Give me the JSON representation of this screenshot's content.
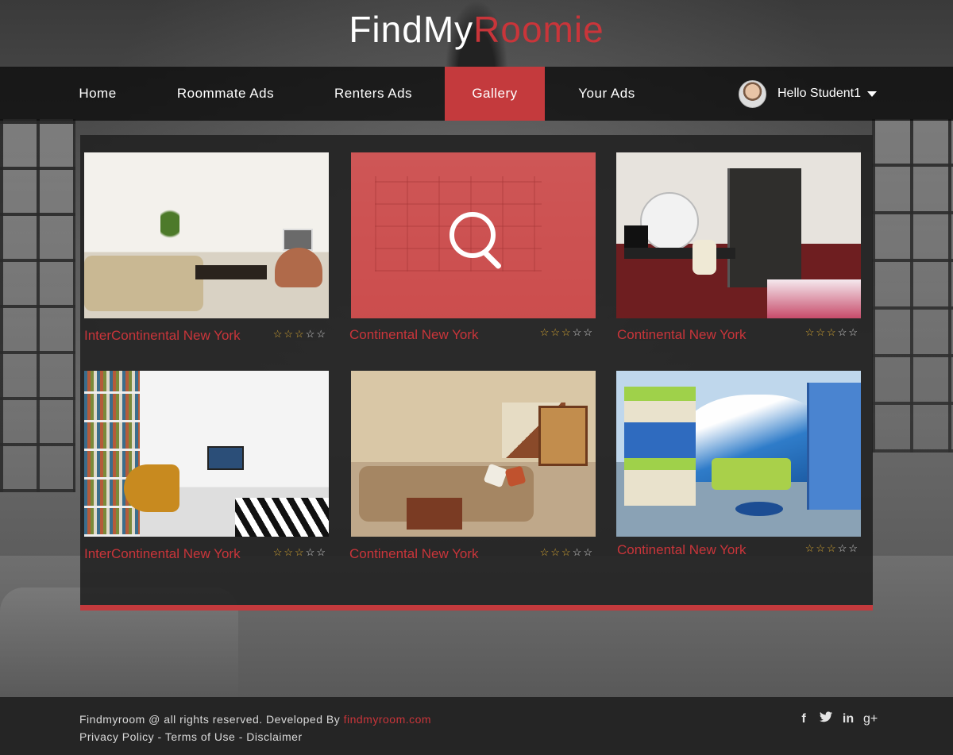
{
  "logo": {
    "part1": "FindMy",
    "part2": "Roomie"
  },
  "nav": {
    "items": [
      {
        "label": "Home"
      },
      {
        "label": "Roommate Ads"
      },
      {
        "label": "Renters Ads"
      },
      {
        "label": "Gallery",
        "active": true
      },
      {
        "label": "Your Ads"
      }
    ],
    "user_greeting": "Hello Student1"
  },
  "gallery": [
    {
      "title": "InterContinental New York",
      "rating": 3,
      "max_rating": 5
    },
    {
      "title": "Continental New York",
      "rating": 3,
      "max_rating": 5,
      "hover": true
    },
    {
      "title": "Continental New York",
      "rating": 3,
      "max_rating": 5
    },
    {
      "title": "InterContinental New York",
      "rating": 3,
      "max_rating": 5
    },
    {
      "title": "Continental New York",
      "rating": 3,
      "max_rating": 5
    },
    {
      "title": "Continental New York",
      "rating": 3,
      "max_rating": 5
    }
  ],
  "footer": {
    "copyright": "Findmyroom @ all rights reserved. Developed By",
    "dev_link": "findmyroom.com",
    "links": [
      "Privacy Policy",
      "Terms of Use",
      "Disclaimer"
    ],
    "separator": " - ",
    "social_icons": [
      "facebook-icon",
      "twitter-icon",
      "linkedin-icon",
      "google-plus-icon"
    ]
  },
  "colors": {
    "accent": "#c43a3d",
    "accent_text": "#c9353a",
    "star_on": "#d4a531",
    "star_off": "#cfcfcf"
  }
}
